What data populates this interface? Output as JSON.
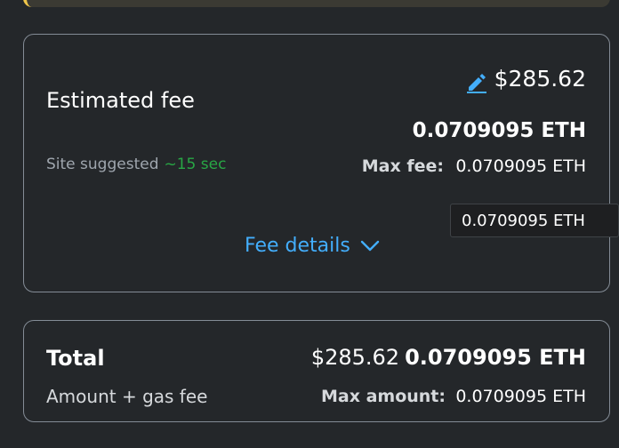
{
  "fee_card": {
    "title": "Estimated fee",
    "edit_icon": "pencil-edit-icon",
    "fiat_amount": "$285.62",
    "eth_amount": "0.0709095 ETH",
    "site_suggested": "Site suggested",
    "time_estimate": "~15 sec",
    "max_fee_label": "Max fee:",
    "max_fee_value": "0.0709095 ETH",
    "fee_details_label": "Fee details",
    "fee_details_icon": "chevron-down-icon",
    "tooltip_text": "0.0709095 ETH"
  },
  "total_card": {
    "title": "Total",
    "fiat_amount": "$285.62",
    "eth_amount": "0.0709095 ETH",
    "subtitle": "Amount + gas fee",
    "max_amount_label": "Max amount:",
    "max_amount_value": "0.0709095 ETH"
  },
  "colors": {
    "background": "#24272a",
    "accent_blue": "#43aefc",
    "time_green": "#28a745",
    "warning_yellow": "#f0c64a"
  }
}
